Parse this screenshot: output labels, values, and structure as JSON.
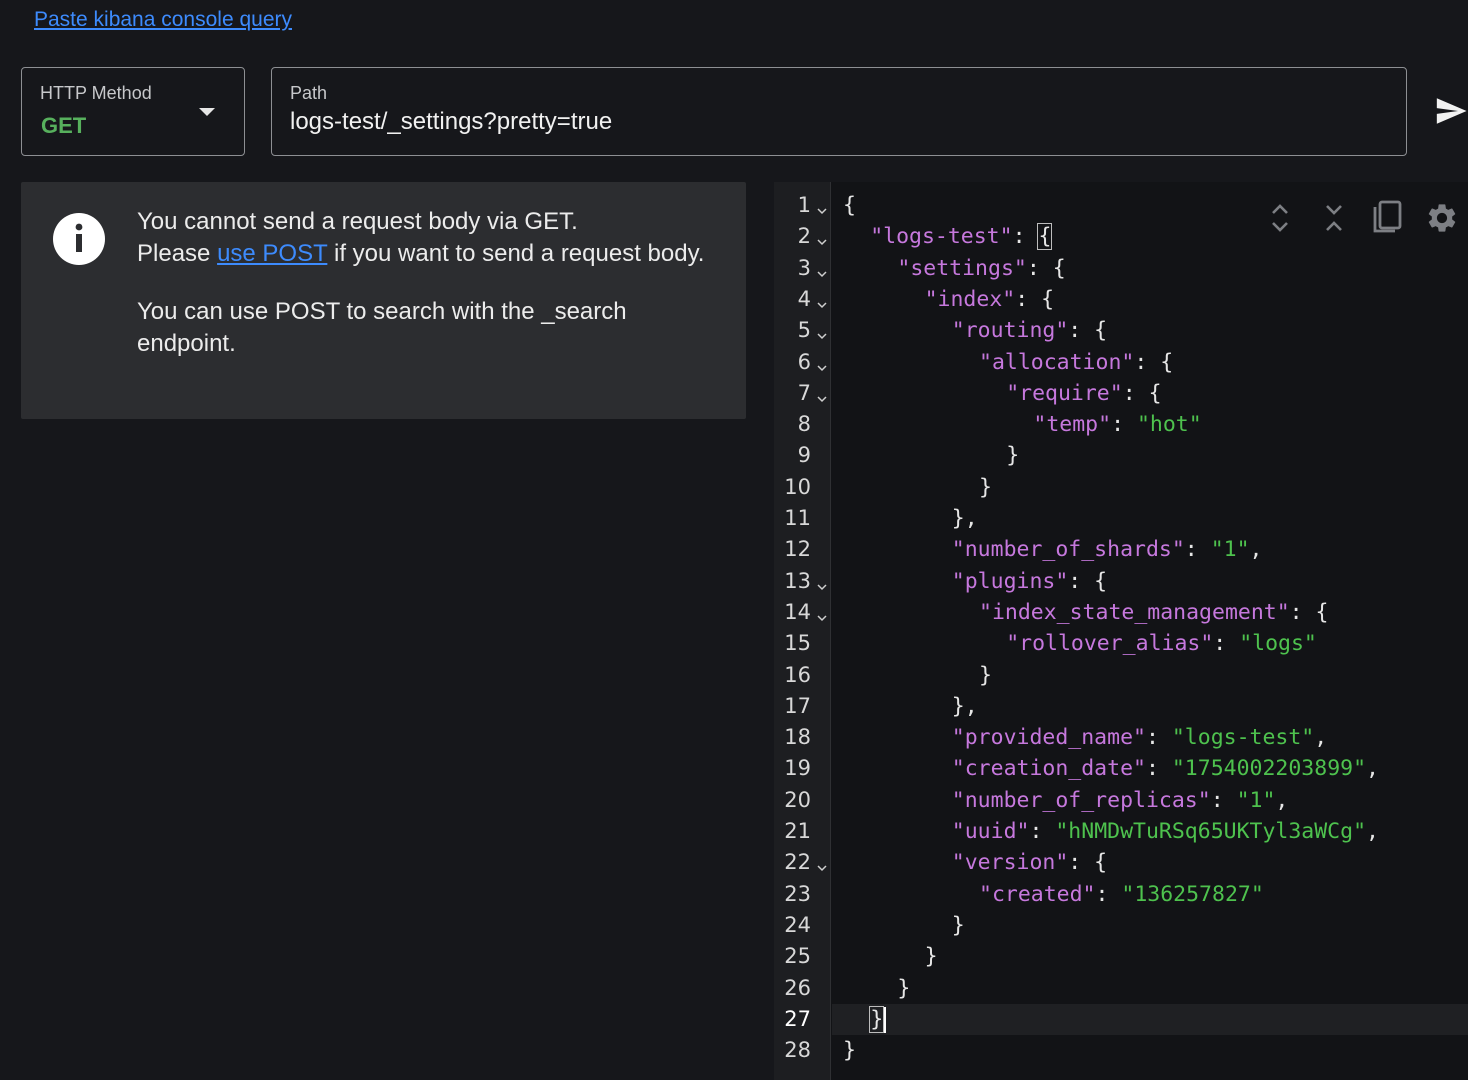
{
  "paste_link": "Paste kibana console query",
  "method": {
    "label": "HTTP Method",
    "value": "GET"
  },
  "path": {
    "label": "Path",
    "value": "logs-test/_settings?pretty=true"
  },
  "info": {
    "line1": "You cannot send a request body via GET.",
    "please": "Please ",
    "link": "use POST",
    "line2_rest": " if you want to send a request body.",
    "line3": "You can use POST to search with the _search endpoint."
  },
  "icons": {
    "send": "send-icon",
    "info": "info-icon",
    "expand": "expand-icon",
    "collapse": "collapse-icon",
    "copy": "copy-icon",
    "settings": "gear-icon"
  },
  "colors": {
    "key": "#c678dd",
    "string": "#4ec24e",
    "method": "#57b05d",
    "link": "#3d8bfd"
  },
  "editor": {
    "active_line": 27,
    "lines": [
      {
        "n": "1",
        "fold": true,
        "indent": 0,
        "parts": [
          {
            "t": "{",
            "c": "p"
          }
        ]
      },
      {
        "n": "2",
        "fold": true,
        "indent": 1,
        "parts": [
          {
            "t": "\"logs-test\"",
            "c": "k"
          },
          {
            "t": ": ",
            "c": "p"
          },
          {
            "t": "{",
            "c": "hl"
          }
        ]
      },
      {
        "n": "3",
        "fold": true,
        "indent": 2,
        "parts": [
          {
            "t": "\"settings\"",
            "c": "k"
          },
          {
            "t": ": {",
            "c": "p"
          }
        ]
      },
      {
        "n": "4",
        "fold": true,
        "indent": 3,
        "parts": [
          {
            "t": "\"index\"",
            "c": "k"
          },
          {
            "t": ": {",
            "c": "p"
          }
        ]
      },
      {
        "n": "5",
        "fold": true,
        "indent": 4,
        "parts": [
          {
            "t": "\"routing\"",
            "c": "k"
          },
          {
            "t": ": {",
            "c": "p"
          }
        ]
      },
      {
        "n": "6",
        "fold": true,
        "indent": 5,
        "parts": [
          {
            "t": "\"allocation\"",
            "c": "k"
          },
          {
            "t": ": {",
            "c": "p"
          }
        ]
      },
      {
        "n": "7",
        "fold": true,
        "indent": 6,
        "parts": [
          {
            "t": "\"require\"",
            "c": "k"
          },
          {
            "t": ": {",
            "c": "p"
          }
        ]
      },
      {
        "n": "8",
        "fold": false,
        "indent": 7,
        "parts": [
          {
            "t": "\"temp\"",
            "c": "k"
          },
          {
            "t": ": ",
            "c": "p"
          },
          {
            "t": "\"hot\"",
            "c": "s"
          }
        ]
      },
      {
        "n": "9",
        "fold": false,
        "indent": 6,
        "parts": [
          {
            "t": "}",
            "c": "p"
          }
        ]
      },
      {
        "n": "10",
        "fold": false,
        "indent": 5,
        "parts": [
          {
            "t": "}",
            "c": "p"
          }
        ]
      },
      {
        "n": "11",
        "fold": false,
        "indent": 4,
        "parts": [
          {
            "t": "},",
            "c": "p"
          }
        ]
      },
      {
        "n": "12",
        "fold": false,
        "indent": 4,
        "parts": [
          {
            "t": "\"number_of_shards\"",
            "c": "k"
          },
          {
            "t": ": ",
            "c": "p"
          },
          {
            "t": "\"1\"",
            "c": "s"
          },
          {
            "t": ",",
            "c": "p"
          }
        ]
      },
      {
        "n": "13",
        "fold": true,
        "indent": 4,
        "parts": [
          {
            "t": "\"plugins\"",
            "c": "k"
          },
          {
            "t": ": {",
            "c": "p"
          }
        ]
      },
      {
        "n": "14",
        "fold": true,
        "indent": 5,
        "parts": [
          {
            "t": "\"index_state_management\"",
            "c": "k"
          },
          {
            "t": ": {",
            "c": "p"
          }
        ]
      },
      {
        "n": "15",
        "fold": false,
        "indent": 6,
        "parts": [
          {
            "t": "\"rollover_alias\"",
            "c": "k"
          },
          {
            "t": ": ",
            "c": "p"
          },
          {
            "t": "\"logs\"",
            "c": "s"
          }
        ]
      },
      {
        "n": "16",
        "fold": false,
        "indent": 5,
        "parts": [
          {
            "t": "}",
            "c": "p"
          }
        ]
      },
      {
        "n": "17",
        "fold": false,
        "indent": 4,
        "parts": [
          {
            "t": "},",
            "c": "p"
          }
        ]
      },
      {
        "n": "18",
        "fold": false,
        "indent": 4,
        "parts": [
          {
            "t": "\"provided_name\"",
            "c": "k"
          },
          {
            "t": ": ",
            "c": "p"
          },
          {
            "t": "\"logs-test\"",
            "c": "s"
          },
          {
            "t": ",",
            "c": "p"
          }
        ]
      },
      {
        "n": "19",
        "fold": false,
        "indent": 4,
        "parts": [
          {
            "t": "\"creation_date\"",
            "c": "k"
          },
          {
            "t": ": ",
            "c": "p"
          },
          {
            "t": "\"1754002203899\"",
            "c": "s"
          },
          {
            "t": ",",
            "c": "p"
          }
        ]
      },
      {
        "n": "20",
        "fold": false,
        "indent": 4,
        "parts": [
          {
            "t": "\"number_of_replicas\"",
            "c": "k"
          },
          {
            "t": ": ",
            "c": "p"
          },
          {
            "t": "\"1\"",
            "c": "s"
          },
          {
            "t": ",",
            "c": "p"
          }
        ]
      },
      {
        "n": "21",
        "fold": false,
        "indent": 4,
        "parts": [
          {
            "t": "\"uuid\"",
            "c": "k"
          },
          {
            "t": ": ",
            "c": "p"
          },
          {
            "t": "\"hNMDwTuRSq65UKTyl3aWCg\"",
            "c": "s"
          },
          {
            "t": ",",
            "c": "p"
          }
        ]
      },
      {
        "n": "22",
        "fold": true,
        "indent": 4,
        "parts": [
          {
            "t": "\"version\"",
            "c": "k"
          },
          {
            "t": ": {",
            "c": "p"
          }
        ]
      },
      {
        "n": "23",
        "fold": false,
        "indent": 5,
        "parts": [
          {
            "t": "\"created\"",
            "c": "k"
          },
          {
            "t": ": ",
            "c": "p"
          },
          {
            "t": "\"136257827\"",
            "c": "s"
          }
        ]
      },
      {
        "n": "24",
        "fold": false,
        "indent": 4,
        "parts": [
          {
            "t": "}",
            "c": "p"
          }
        ]
      },
      {
        "n": "25",
        "fold": false,
        "indent": 3,
        "parts": [
          {
            "t": "}",
            "c": "p"
          }
        ]
      },
      {
        "n": "26",
        "fold": false,
        "indent": 2,
        "parts": [
          {
            "t": "}",
            "c": "p"
          }
        ]
      },
      {
        "n": "27",
        "fold": false,
        "indent": 1,
        "parts": [
          {
            "t": "}",
            "c": "hl"
          },
          {
            "t": "",
            "c": "cursor"
          }
        ]
      },
      {
        "n": "28",
        "fold": false,
        "indent": 0,
        "parts": [
          {
            "t": "}",
            "c": "p"
          }
        ]
      }
    ]
  }
}
